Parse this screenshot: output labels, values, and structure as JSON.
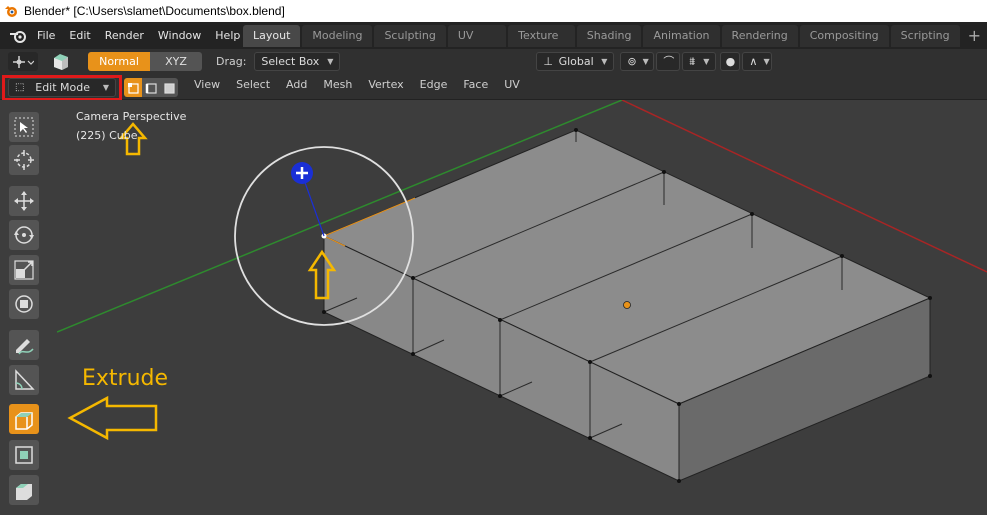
{
  "window": {
    "title": "Blender* [C:\\Users\\slamet\\Documents\\box.blend]"
  },
  "menu": [
    "File",
    "Edit",
    "Render",
    "Window",
    "Help"
  ],
  "workspace_tabs": [
    "Layout",
    "Modeling",
    "Sculpting",
    "UV Editing",
    "Texture Paint",
    "Shading",
    "Animation",
    "Rendering",
    "Compositing",
    "Scripting"
  ],
  "active_tab": "Layout",
  "header": {
    "orientation_normal": "Normal",
    "orientation_xyz": "XYZ",
    "drag_label": "Drag:",
    "drag_value": "Select Box",
    "transform_orientation": "Global"
  },
  "header2": {
    "mode": "Edit Mode",
    "menus": [
      "View",
      "Select",
      "Add",
      "Mesh",
      "Vertex",
      "Edge",
      "Face",
      "UV"
    ]
  },
  "viewport": {
    "camera_label": "Camera Perspective",
    "object_label": "(225) Cube"
  },
  "annotation": {
    "extrude": "Extrude"
  },
  "colors": {
    "accent": "#e8921a",
    "highlight_red": "#e01a1a",
    "arrow_yellow": "#f5b800",
    "gizmo_blue": "#1a2fd6"
  }
}
